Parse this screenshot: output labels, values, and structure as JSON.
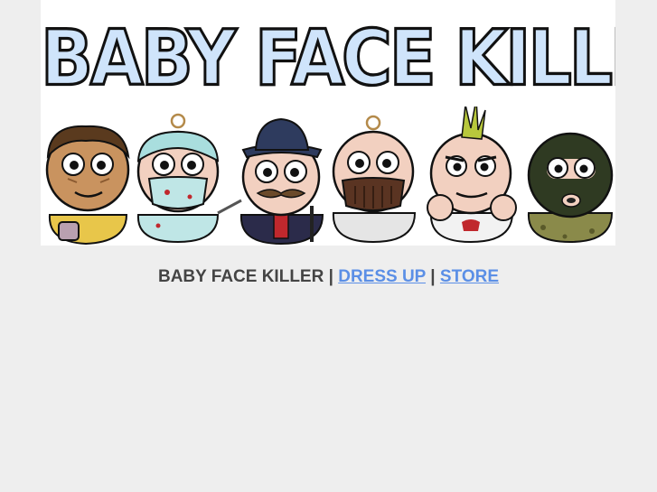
{
  "banner": {
    "title": "BABY FACE KILLER",
    "title_fill": "#cfe4fb",
    "characters": [
      {
        "name": "leatherface-icon",
        "mask_color": "#c9935f",
        "hair_color": "#5a3a1e",
        "outfit_color": "#e8c64a"
      },
      {
        "name": "surgeon-icon",
        "mask_color": "#bfe6e6",
        "hair_color": "#a9dede",
        "outfit_color": "#bfe6e6"
      },
      {
        "name": "hat-killer-icon",
        "mask_color": "#f2d0c0",
        "hair_color": "#2e3b5e",
        "outfit_color": "#2b2b4a"
      },
      {
        "name": "hannibal-mask-icon",
        "mask_color": "#5a3422",
        "hair_color": "#f2d0c0",
        "outfit_color": "#e5e5e5"
      },
      {
        "name": "punk-icon",
        "mask_color": "#f2d0c0",
        "hair_color": "#b8c83c",
        "outfit_color": "#f2f2f2"
      },
      {
        "name": "balaclava-icon",
        "mask_color": "#2f3a22",
        "hair_color": "#2f3a22",
        "outfit_color": "#8a8a4a"
      }
    ]
  },
  "nav": {
    "home": "BABY FACE KILLER",
    "separator": "|",
    "dress_up": "DRESS UP",
    "store": "STORE"
  },
  "colors": {
    "page_background": "#eeeeee",
    "link": "#5b8fe6",
    "text": "#444444"
  }
}
